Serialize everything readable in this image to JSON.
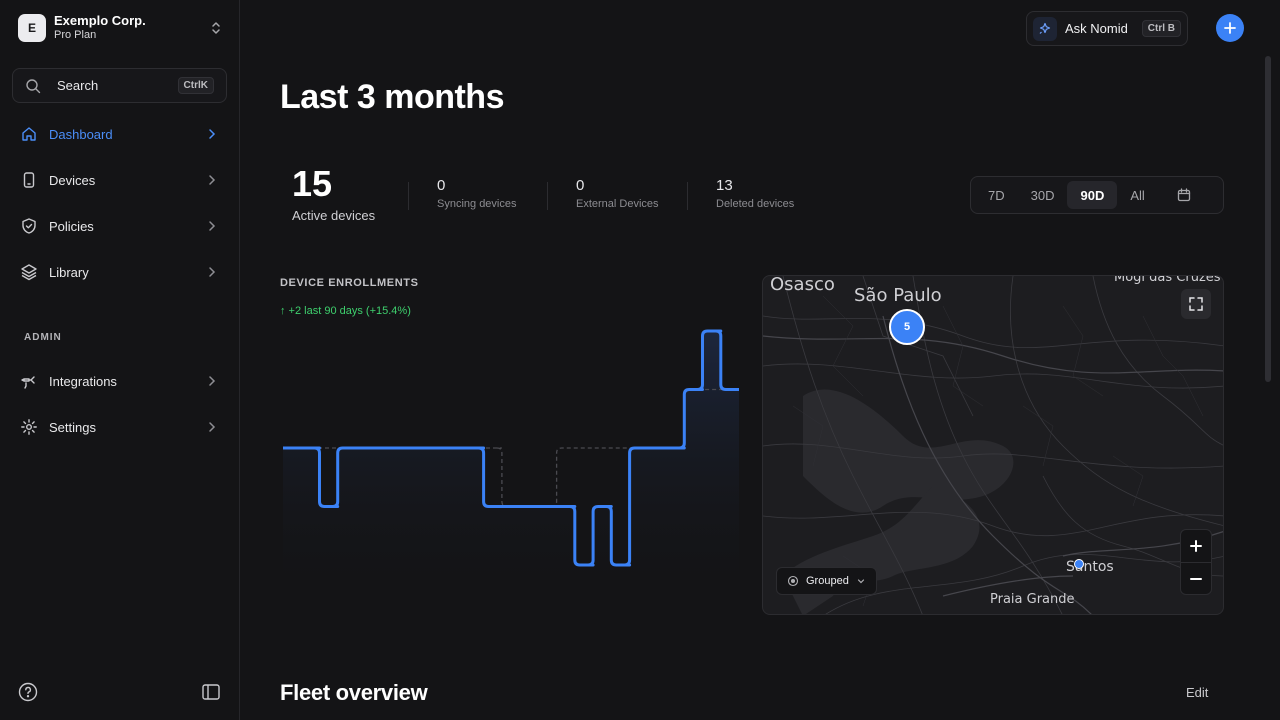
{
  "sidebar": {
    "org": {
      "avatar": "E",
      "name": "Exemplo Corp.",
      "plan": "Pro Plan",
      "switch_icon": "chevrons-up-down-icon"
    },
    "search": {
      "label": "Search",
      "shortcut": "CtrlK"
    },
    "items": [
      {
        "label": "Dashboard",
        "icon": "home-icon",
        "active": true
      },
      {
        "label": "Devices",
        "icon": "smartphone-icon"
      },
      {
        "label": "Policies",
        "icon": "shield-check-icon"
      },
      {
        "label": "Library",
        "icon": "layers-icon"
      }
    ],
    "admin_label": "ADMIN",
    "admin_items": [
      {
        "label": "Integrations",
        "icon": "plug-icon"
      },
      {
        "label": "Settings",
        "icon": "gear-icon"
      }
    ]
  },
  "topbar": {
    "ask_label": "Ask Nomid",
    "ask_shortcut": "Ctrl B"
  },
  "main": {
    "title": "Last 3 months",
    "stats": {
      "active": {
        "value": "15",
        "label": "Active devices"
      },
      "syncing": {
        "value": "0",
        "label": "Syncing devices"
      },
      "external": {
        "value": "0",
        "label": "External Devices"
      },
      "deleted": {
        "value": "13",
        "label": "Deleted devices"
      }
    },
    "range": {
      "options": [
        "7D",
        "30D",
        "90D",
        "All"
      ],
      "selected": "90D"
    },
    "fleet_title": "Fleet overview",
    "edit_label": "Edit"
  },
  "chart_data": {
    "type": "line",
    "title": "DEVICE ENROLLMENTS",
    "delta": "↑ +2 last 90 days (+15.4%)",
    "accent": "#3b82f6",
    "series": [
      {
        "values": [
          13,
          13,
          12,
          13,
          13,
          13,
          13,
          13,
          13,
          13,
          13,
          12,
          12,
          12,
          12,
          12,
          11,
          12,
          11,
          13,
          13,
          13,
          14,
          15,
          14
        ]
      },
      {
        "values": [
          13,
          13,
          13,
          13,
          13,
          13,
          13,
          13,
          13,
          13,
          13,
          13,
          12,
          12,
          12,
          13,
          13,
          13,
          13,
          13,
          13,
          13,
          14,
          14,
          14
        ]
      }
    ]
  },
  "map": {
    "places": [
      "Osasco",
      "São Paulo",
      "Mogi das Cruzes",
      "Santos",
      "Praia Grande"
    ],
    "cluster_count": "5",
    "group_label": "Grouped",
    "zoom_in": "+",
    "zoom_out": "−"
  },
  "colors": {
    "accent": "#3b82f6",
    "positive": "#3ecf6d",
    "background": "#141416"
  }
}
